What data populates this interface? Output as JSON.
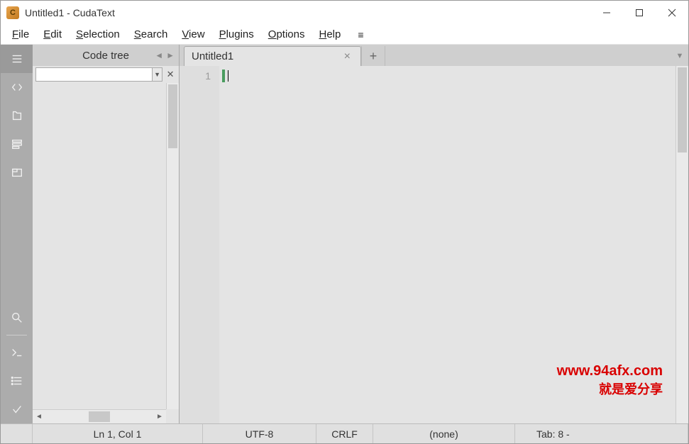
{
  "titlebar": {
    "title": "Untitled1 - CudaText"
  },
  "menu": {
    "items": [
      {
        "u": "F",
        "rest": "ile"
      },
      {
        "u": "E",
        "rest": "dit"
      },
      {
        "u": "S",
        "rest": "election"
      },
      {
        "u": "S",
        "rest": "earch"
      },
      {
        "u": "V",
        "rest": "iew"
      },
      {
        "u": "P",
        "rest": "lugins"
      },
      {
        "u": "O",
        "rest": "ptions"
      },
      {
        "u": "H",
        "rest": "elp"
      }
    ]
  },
  "activity": {
    "items": [
      "menu",
      "code",
      "project",
      "tree",
      "tabs"
    ],
    "bottom": [
      "search",
      "console",
      "list",
      "check"
    ]
  },
  "sidepanel": {
    "title": "Code tree",
    "filter_value": "",
    "filter_placeholder": ""
  },
  "tabs": {
    "items": [
      {
        "label": "Untitled1"
      }
    ],
    "add": "+"
  },
  "editor": {
    "line_numbers": [
      "1"
    ],
    "content": ""
  },
  "status": {
    "position": "Ln 1, Col 1",
    "encoding": "UTF-8",
    "line_ending": "CRLF",
    "lexer": "(none)",
    "tab": "Tab: 8 -"
  },
  "watermark": {
    "url": "www.94afx.com",
    "text": "就是爱分享"
  }
}
